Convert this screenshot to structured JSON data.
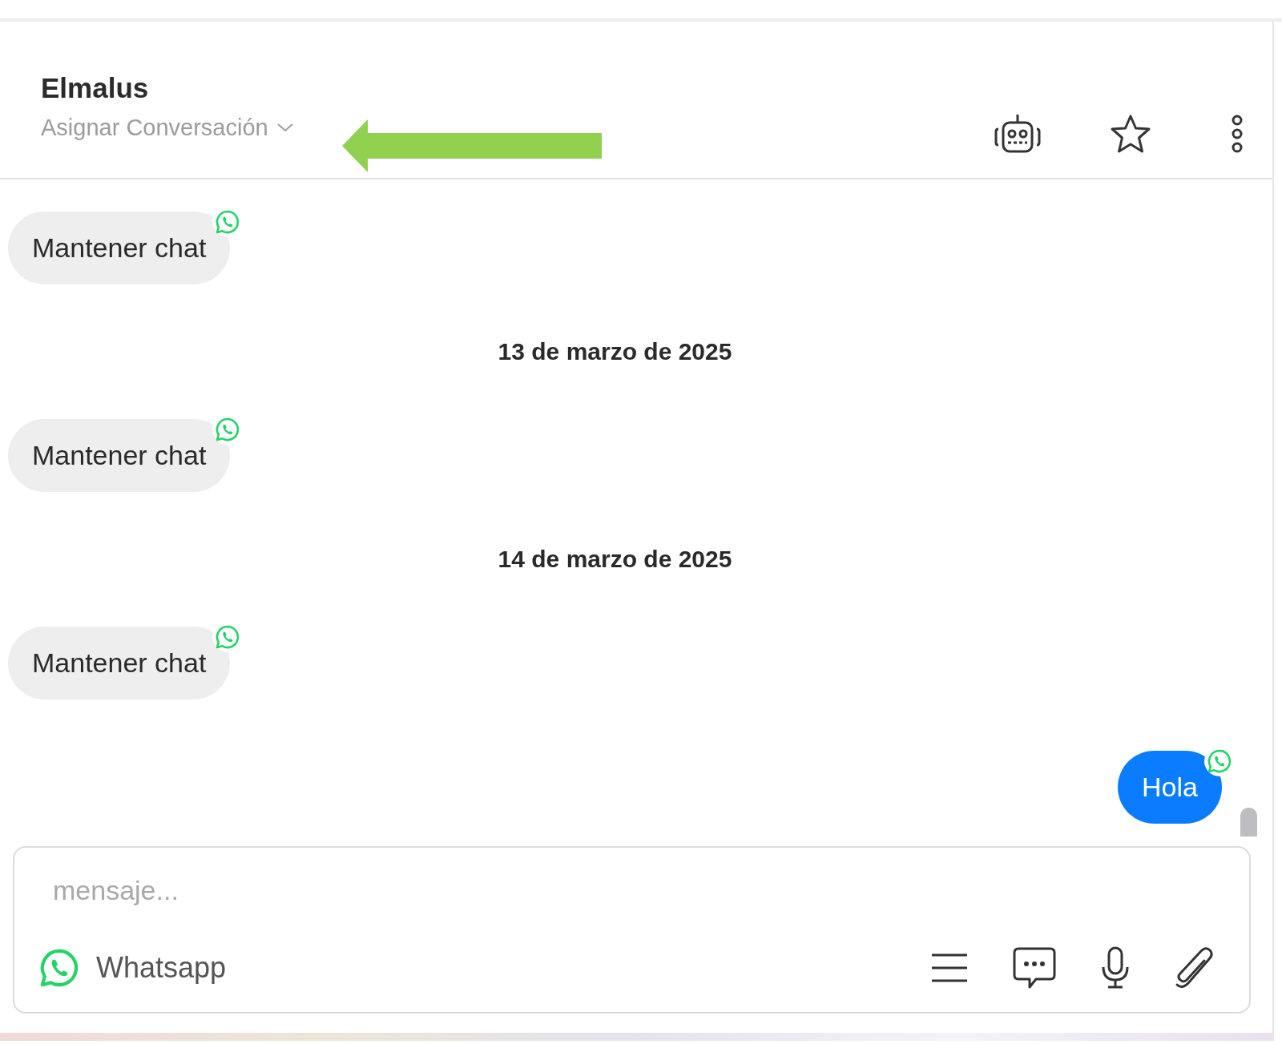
{
  "header": {
    "contact_name": "Elmalus",
    "assign_label": "Asignar Conversación"
  },
  "messages": [
    {
      "kind": "incoming",
      "text": "Mantener chat"
    },
    {
      "kind": "date",
      "text": "13 de marzo de 2025"
    },
    {
      "kind": "incoming",
      "text": "Mantener chat"
    },
    {
      "kind": "date",
      "text": "14 de marzo de 2025"
    },
    {
      "kind": "incoming",
      "text": "Mantener chat"
    },
    {
      "kind": "outgoing",
      "text": "Hola"
    }
  ],
  "composer": {
    "placeholder": "mensaje...",
    "channel": "Whatsapp"
  }
}
